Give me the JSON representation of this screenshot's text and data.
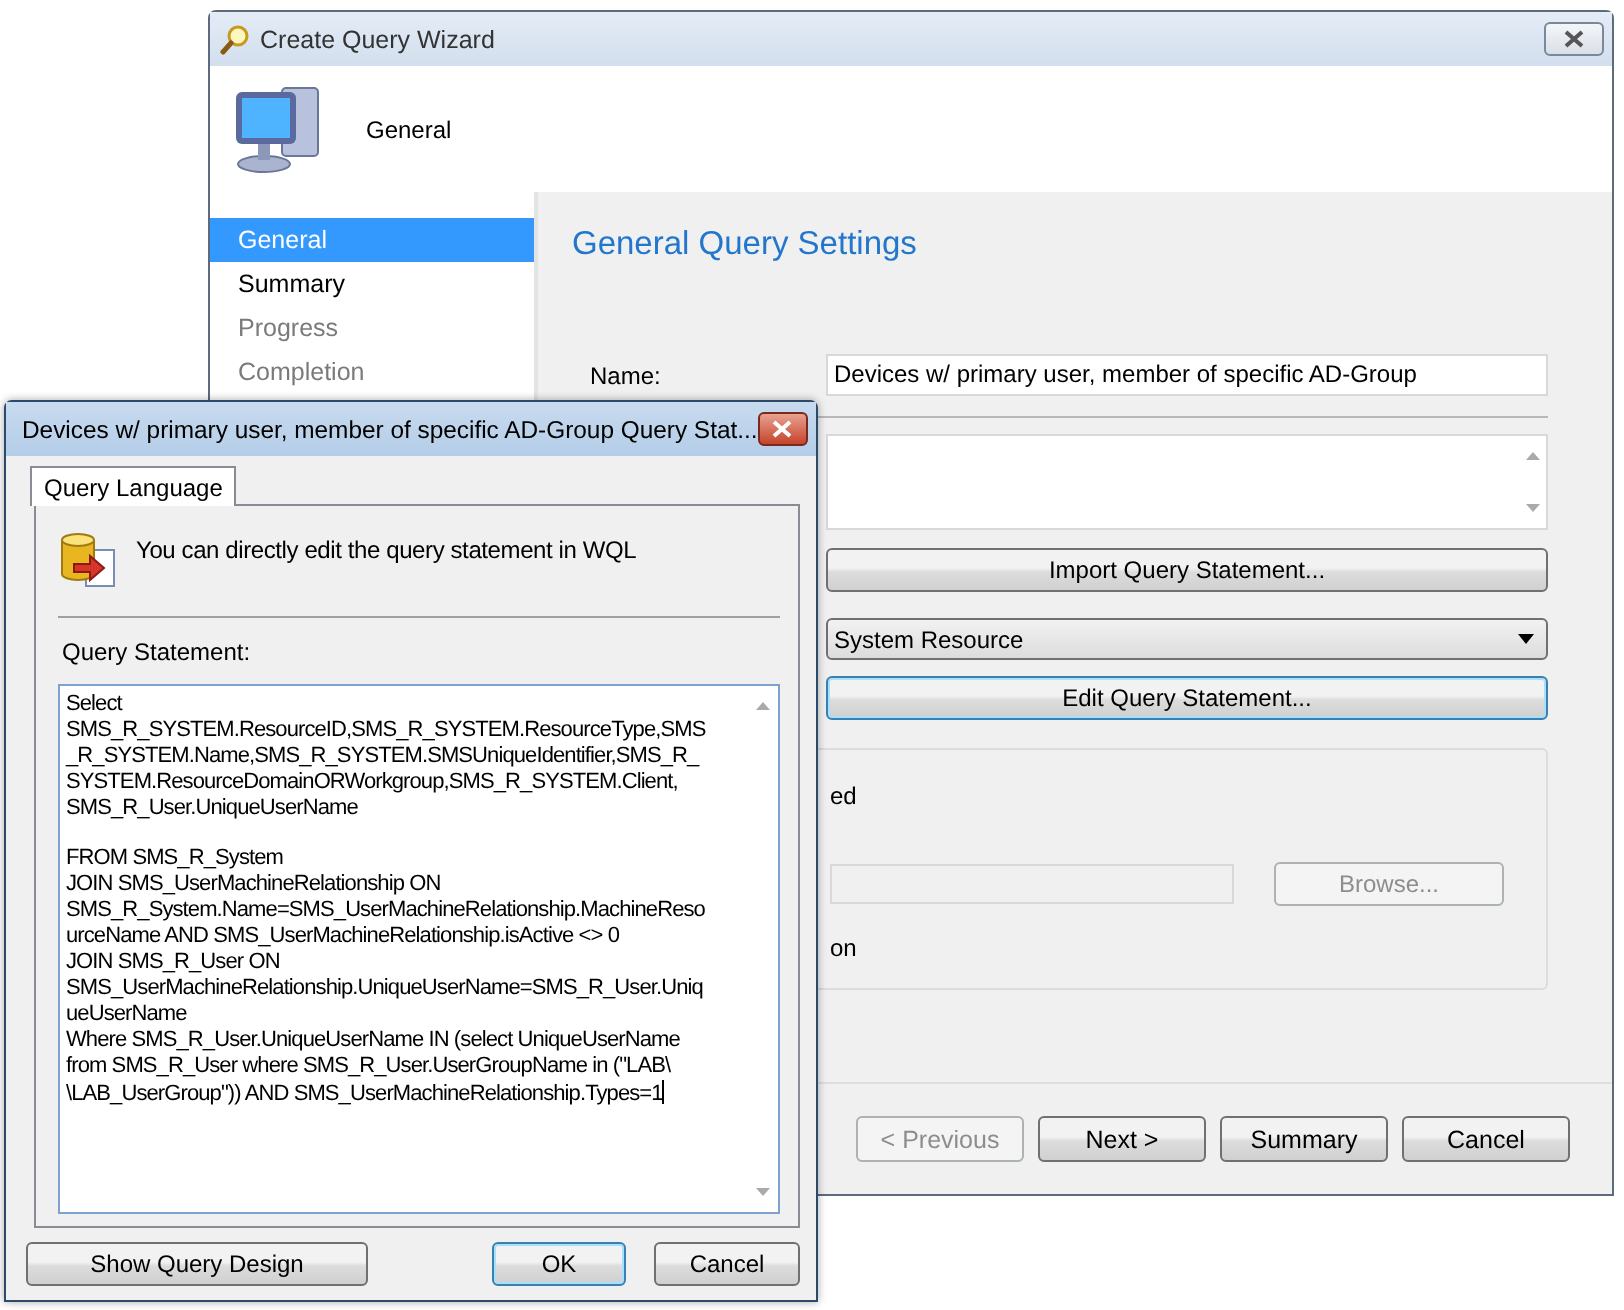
{
  "wizard": {
    "title": "Create Query Wizard",
    "header": "General",
    "nav": [
      {
        "label": "General",
        "selected": true,
        "disabled": false
      },
      {
        "label": "Summary",
        "selected": false,
        "disabled": false
      },
      {
        "label": "Progress",
        "selected": false,
        "disabled": true
      },
      {
        "label": "Completion",
        "selected": false,
        "disabled": true
      }
    ],
    "heading": "General Query Settings",
    "name_label": "Name:",
    "name_value": "Devices w/ primary user, member of specific AD-Group",
    "import_button": "Import Query Statement...",
    "class_dropdown": "System Resource",
    "edit_button": "Edit Query Statement...",
    "group_text_1": "ed",
    "group_text_2": "on",
    "browse_button": {
      "label": "Browse...",
      "disabled": true
    },
    "buttons": [
      {
        "label": "< Previous",
        "disabled": true
      },
      {
        "label": "Next >",
        "disabled": false
      },
      {
        "label": "Summary",
        "disabled": false
      },
      {
        "label": "Cancel",
        "disabled": false
      }
    ]
  },
  "dialog": {
    "title": "Devices w/ primary user, member of specific AD-Group Query Stat...",
    "tabs": [
      {
        "label": "Query Language",
        "selected": true
      }
    ],
    "info": "You can directly edit the query statement in WQL",
    "statement_label": "Query Statement:",
    "statement": [
      [
        "Select",
        "SMS_R_SYSTEM.ResourceID,SMS_R_SYSTEM.ResourceType,SMS",
        "_R_SYSTEM.Name,SMS_R_SYSTEM.SMSUniqueIdentifier,SMS_R_",
        "SYSTEM.ResourceDomainORWorkgroup,SMS_R_SYSTEM.Client,",
        "SMS_R_User.UniqueUserName"
      ],
      [
        "FROM SMS_R_System",
        "JOIN SMS_UserMachineRelationship ON",
        "SMS_R_System.Name=SMS_UserMachineRelationship.MachineReso",
        "urceName AND SMS_UserMachineRelationship.isActive <> 0",
        "JOIN SMS_R_User ON",
        "SMS_UserMachineRelationship.UniqueUserName=SMS_R_User.Uniq",
        "ueUserName",
        "Where SMS_R_User.UniqueUserName IN (select UniqueUserName",
        "from SMS_R_User where SMS_R_User.UserGroupName in (\"LAB\\",
        "\\LAB_UserGroup\")) AND SMS_UserMachineRelationship.Types=1"
      ]
    ],
    "buttons": [
      {
        "label": "Show Query Design",
        "focused": false
      },
      {
        "label": "OK",
        "focused": true
      },
      {
        "label": "Cancel",
        "focused": false
      }
    ]
  }
}
